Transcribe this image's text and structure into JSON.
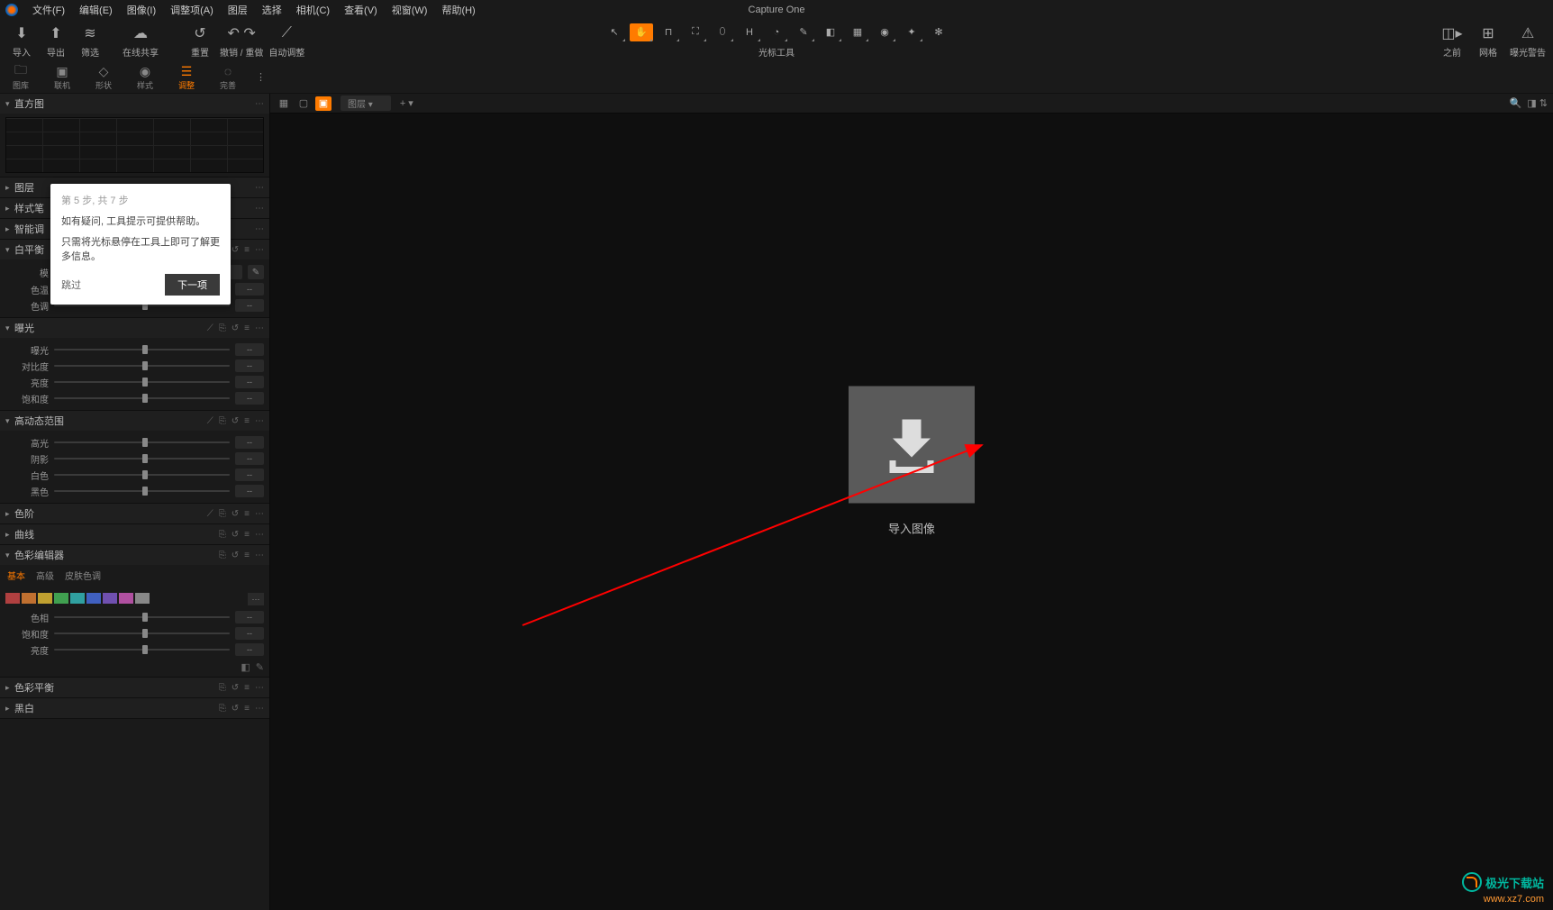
{
  "app_title": "Capture One",
  "menu": [
    "文件(F)",
    "编辑(E)",
    "图像(I)",
    "调整项(A)",
    "图层",
    "选择",
    "相机(C)",
    "查看(V)",
    "视窗(W)",
    "帮助(H)"
  ],
  "toolbar_left": [
    {
      "name": "import",
      "label": "导入",
      "icon": "⬇"
    },
    {
      "name": "export",
      "label": "导出",
      "icon": "⬆"
    },
    {
      "name": "filter",
      "label": "筛选",
      "icon": "≈"
    }
  ],
  "toolbar_share": {
    "label": "在线共享",
    "icon": "⎌"
  },
  "toolbar_history": [
    {
      "name": "reset",
      "label": "重置",
      "icon": "↶"
    },
    {
      "name": "undo-redo",
      "label": "撤销 / 重做",
      "icon": "↶ ↷"
    },
    {
      "name": "auto-adjust",
      "label": "自动调整",
      "icon": "✎"
    }
  ],
  "cursor_label": "光标工具",
  "cursor_tools": [
    "select",
    "hand",
    "loupe",
    "crop",
    "keystone",
    "spot",
    "mask",
    "draw",
    "erase",
    "linear",
    "radial",
    "magic",
    "style"
  ],
  "right_tools": [
    {
      "name": "before-after",
      "label": "之前",
      "icon": "◫"
    },
    {
      "name": "grid",
      "label": "网格",
      "icon": "⊞"
    },
    {
      "name": "exposure-warning",
      "label": "曝光警告",
      "icon": "⚠"
    }
  ],
  "tool_tabs": [
    {
      "name": "library",
      "label": "图库",
      "icon": "🗀"
    },
    {
      "name": "tether",
      "label": "联机",
      "icon": "📷"
    },
    {
      "name": "shape",
      "label": "形状",
      "icon": "◆"
    },
    {
      "name": "style",
      "label": "样式",
      "icon": "◉"
    },
    {
      "name": "adjust",
      "label": "调整",
      "icon": "⚙",
      "active": true
    },
    {
      "name": "refine",
      "label": "完善",
      "icon": "◌"
    }
  ],
  "viewer": {
    "layer_dropdown": "图层",
    "import_label": "导入图像"
  },
  "panels": {
    "histogram": "直方图",
    "layers": "图层",
    "style_brush": "样式笔",
    "smart_adjust": "智能调",
    "white_balance": {
      "title": "白平衡",
      "mode_label": "模",
      "sliders": [
        "色温",
        "色调"
      ]
    },
    "exposure": {
      "title": "曝光",
      "sliders": [
        "曝光",
        "对比度",
        "亮度",
        "饱和度"
      ]
    },
    "hdr": {
      "title": "高动态范围",
      "sliders": [
        "高光",
        "阴影",
        "白色",
        "黑色"
      ]
    },
    "levels": "色阶",
    "curve": "曲线",
    "color_editor": {
      "title": "色彩编辑器",
      "tabs": [
        "基本",
        "高级",
        "皮肤色调"
      ],
      "sliders": [
        "色相",
        "饱和度",
        "亮度"
      ],
      "swatches": [
        "#b04040",
        "#c07030",
        "#c0a030",
        "#40a050",
        "#30a0a0",
        "#4060c0",
        "#7050b0",
        "#b050a0",
        "#888"
      ]
    },
    "color_balance": "色彩平衡",
    "bw": "黑白"
  },
  "tooltip": {
    "step": "第 5 步, 共 7 步",
    "msg1": "如有疑问, 工具提示可提供帮助。",
    "msg2": "只需将光标悬停在工具上即可了解更多信息。",
    "skip": "跳过",
    "next": "下一项"
  },
  "watermark": {
    "text": "极光下载站",
    "url": "www.xz7.com"
  }
}
